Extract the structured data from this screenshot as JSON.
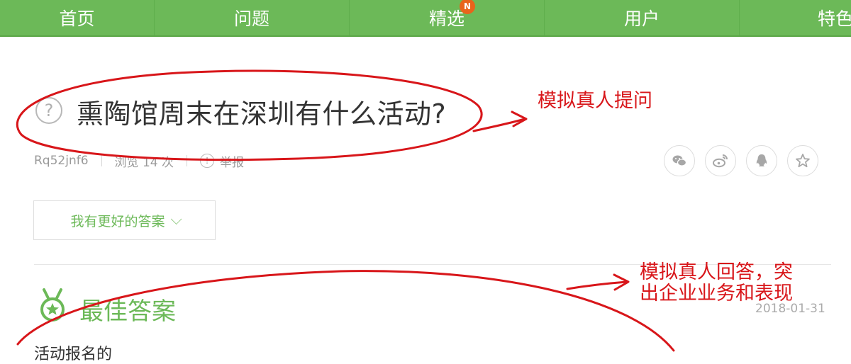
{
  "nav": {
    "items": [
      {
        "label": "首页"
      },
      {
        "label": "问题"
      },
      {
        "label": "精选",
        "badge": "N"
      },
      {
        "label": "用户"
      },
      {
        "label": "特色"
      }
    ],
    "background_color": "#6cb958",
    "badge_color": "#e8641b"
  },
  "question": {
    "icon": "question-circle-icon",
    "title": "熏陶馆周末在深圳有什么活动?",
    "author": "Rq52jnf6",
    "views": "浏览 14 次",
    "report": "举报"
  },
  "share": {
    "icons": [
      "wechat-icon",
      "weibo-icon",
      "qq-icon",
      "star-icon"
    ]
  },
  "answer_button": {
    "label": "我有更好的答案"
  },
  "best_answer": {
    "title": "最佳答案",
    "date": "2018-01-31",
    "text": "活动报名的",
    "accent_color": "#6cb958"
  },
  "annotations": {
    "question_note": "模拟真人提问",
    "answer_note": "模拟真人回答，突出企业业务和表现",
    "color": "#d8161a"
  }
}
